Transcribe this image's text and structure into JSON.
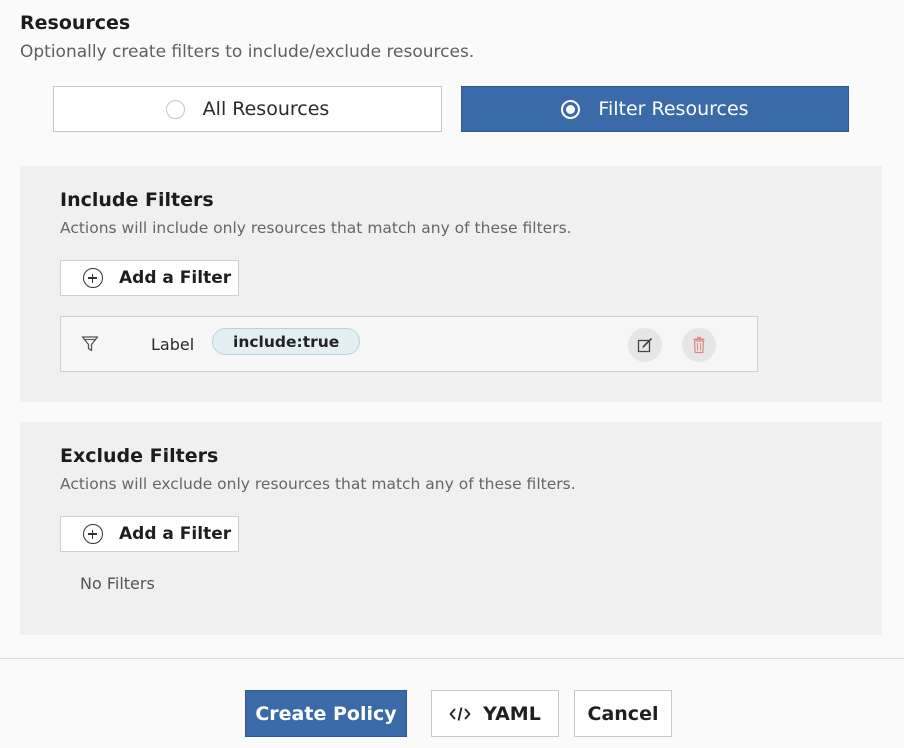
{
  "resources": {
    "heading": "Resources",
    "description": "Optionally create filters to include/exclude resources.",
    "options": [
      {
        "label": "All Resources",
        "selected": false
      },
      {
        "label": "Filter Resources",
        "selected": true
      }
    ]
  },
  "include": {
    "title": "Include Filters",
    "description": "Actions will include only resources that match any of these filters.",
    "add_label": "Add a Filter",
    "filters": [
      {
        "type": "Label",
        "value": "include:true"
      }
    ]
  },
  "exclude": {
    "title": "Exclude Filters",
    "description": "Actions will exclude only resources that match any of these filters.",
    "add_label": "Add a Filter",
    "empty_text": "No Filters"
  },
  "footer": {
    "create_label": "Create Policy",
    "yaml_label": "YAML",
    "cancel_label": "Cancel"
  },
  "colors": {
    "accent": "#3b6aa8",
    "panel_bg": "#f0f0f0",
    "tag_bg": "#e3eff3",
    "delete_icon": "#e08a8a"
  },
  "icons": {
    "plus": "plus-circle-icon",
    "filter": "funnel-icon",
    "edit": "edit-icon",
    "delete": "trash-icon",
    "code": "code-icon"
  }
}
